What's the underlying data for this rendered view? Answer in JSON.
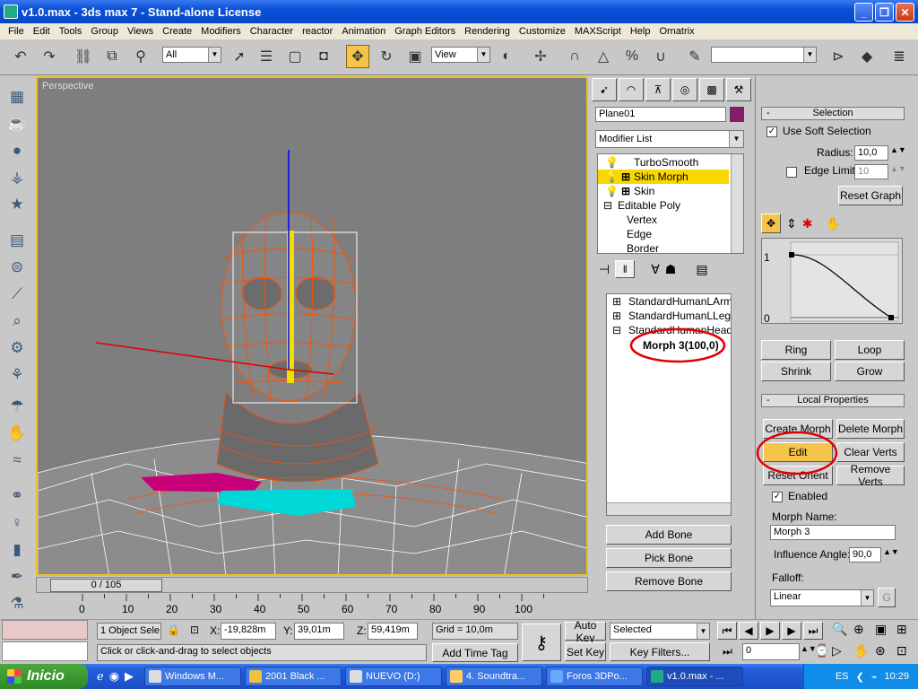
{
  "window": {
    "title": "v1.0.max - 3ds max 7 - Stand-alone License"
  },
  "menu": [
    "File",
    "Edit",
    "Tools",
    "Group",
    "Views",
    "Create",
    "Modifiers",
    "Character",
    "reactor",
    "Animation",
    "Graph Editors",
    "Rendering",
    "Customize",
    "MAXScript",
    "Help",
    "Ornatrix"
  ],
  "toolbar": {
    "filter": "All",
    "refcoord": "View"
  },
  "viewport": {
    "label": "Perspective"
  },
  "timeline": {
    "frame": "0 / 105",
    "ticks": [
      "0",
      "10",
      "20",
      "30",
      "40",
      "50",
      "60",
      "70",
      "80",
      "90",
      "100"
    ]
  },
  "command": {
    "object_name": "Plane01",
    "modifier_list": "Modifier List",
    "stack": [
      "TurboSmooth",
      "Skin Morph",
      "Skin",
      "Editable Poly",
      "Vertex",
      "Edge",
      "Border"
    ],
    "bones": [
      "StandardHumanLArm02",
      "StandardHumanLLeg01",
      "StandardHumanHead"
    ],
    "morph_entry": "Morph 3(100,0)",
    "add_bone": "Add Bone",
    "pick_bone": "Pick Bone",
    "remove_bone": "Remove Bone"
  },
  "selection": {
    "title": "Selection",
    "use_soft": "Use Soft Selection",
    "radius_label": "Radius:",
    "radius": "10,0",
    "edge_limit_label": "Edge Limit:",
    "edge_limit": "10",
    "reset_graph": "Reset Graph",
    "graph_top": "1",
    "graph_bottom": "0",
    "ring": "Ring",
    "loop": "Loop",
    "shrink": "Shrink",
    "grow": "Grow"
  },
  "local": {
    "title": "Local Properties",
    "create_morph": "Create Morph",
    "delete_morph": "Delete Morph",
    "edit": "Edit",
    "clear_verts": "Clear Verts",
    "reset_orient": "Reset Orient",
    "remove_verts": "Remove Verts",
    "enabled": "Enabled",
    "morph_name_label": "Morph Name:",
    "morph_name": "Morph 3",
    "influence_label": "Influence Angle:",
    "influence": "90,0",
    "falloff_label": "Falloff:",
    "falloff": "Linear"
  },
  "status": {
    "selected": "1 Object Sele",
    "x_label": "X:",
    "x": "-19,828m",
    "y_label": "Y:",
    "y": "39,01m",
    "z_label": "Z:",
    "z": "59,419m",
    "grid": "Grid = 10,0m",
    "prompt": "Click or click-and-drag to select objects",
    "add_time_tag": "Add Time Tag",
    "auto_key": "Auto Key",
    "set_key": "Set Key",
    "key_mode": "Selected",
    "key_filters": "Key Filters...",
    "frame_field": "0"
  },
  "taskbar": {
    "start": "Inicio",
    "tasks": [
      "Windows M...",
      "2001 Black ...",
      "NUEVO (D:)",
      "4. Soundtra...",
      "Foros 3DPo...",
      "v1.0.max - ..."
    ],
    "lang": "ES",
    "time": "10:29"
  },
  "colors": {
    "active": "#f5c44a",
    "mesh": "#ff5000",
    "annotation": "#e00000"
  }
}
